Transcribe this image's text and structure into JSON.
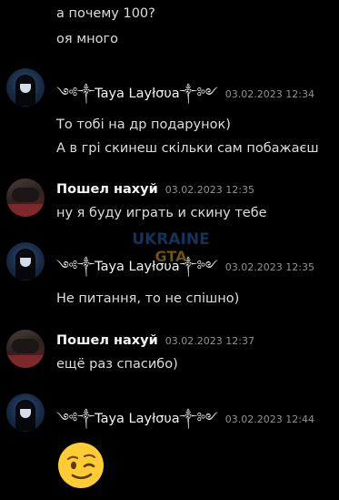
{
  "messages": {
    "top_lines": [
      "а почему 100?",
      "оя много"
    ],
    "group1": {
      "author": "༺༒Taya Layłσυa༒༻",
      "timestamp": "03.02.2023 12:34",
      "lines": [
        "То тобі на др подарунок)",
        "А в грі скинеш скільки сам побажаєш"
      ]
    },
    "group2": {
      "author": "Пошел нахуй",
      "timestamp": "03.02.2023 12:35",
      "lines": [
        "ну я буду играть и скину тебе"
      ]
    },
    "group3": {
      "author": "༺༒Taya Layłσυa༒༻",
      "timestamp": "03.02.2023 12:35",
      "lines": [
        "Не питання, то не спішно)"
      ]
    },
    "group4": {
      "author": "Пошел нахуй",
      "timestamp": "03.02.2023 12:37",
      "lines": [
        "ещё раз спасибо)"
      ]
    },
    "group5": {
      "author": "༺༒Taya Layłσυa༒༻",
      "timestamp": "03.02.2023 12:44",
      "emoji": "winking-face"
    }
  },
  "watermark": {
    "line1": "UKRAINE",
    "line2": "GTA"
  },
  "colors": {
    "background": "#000000",
    "text": "#dcddde",
    "username": "#f2f3f5",
    "timestamp": "#8e9297",
    "emoji_face": "#ffcc33"
  }
}
